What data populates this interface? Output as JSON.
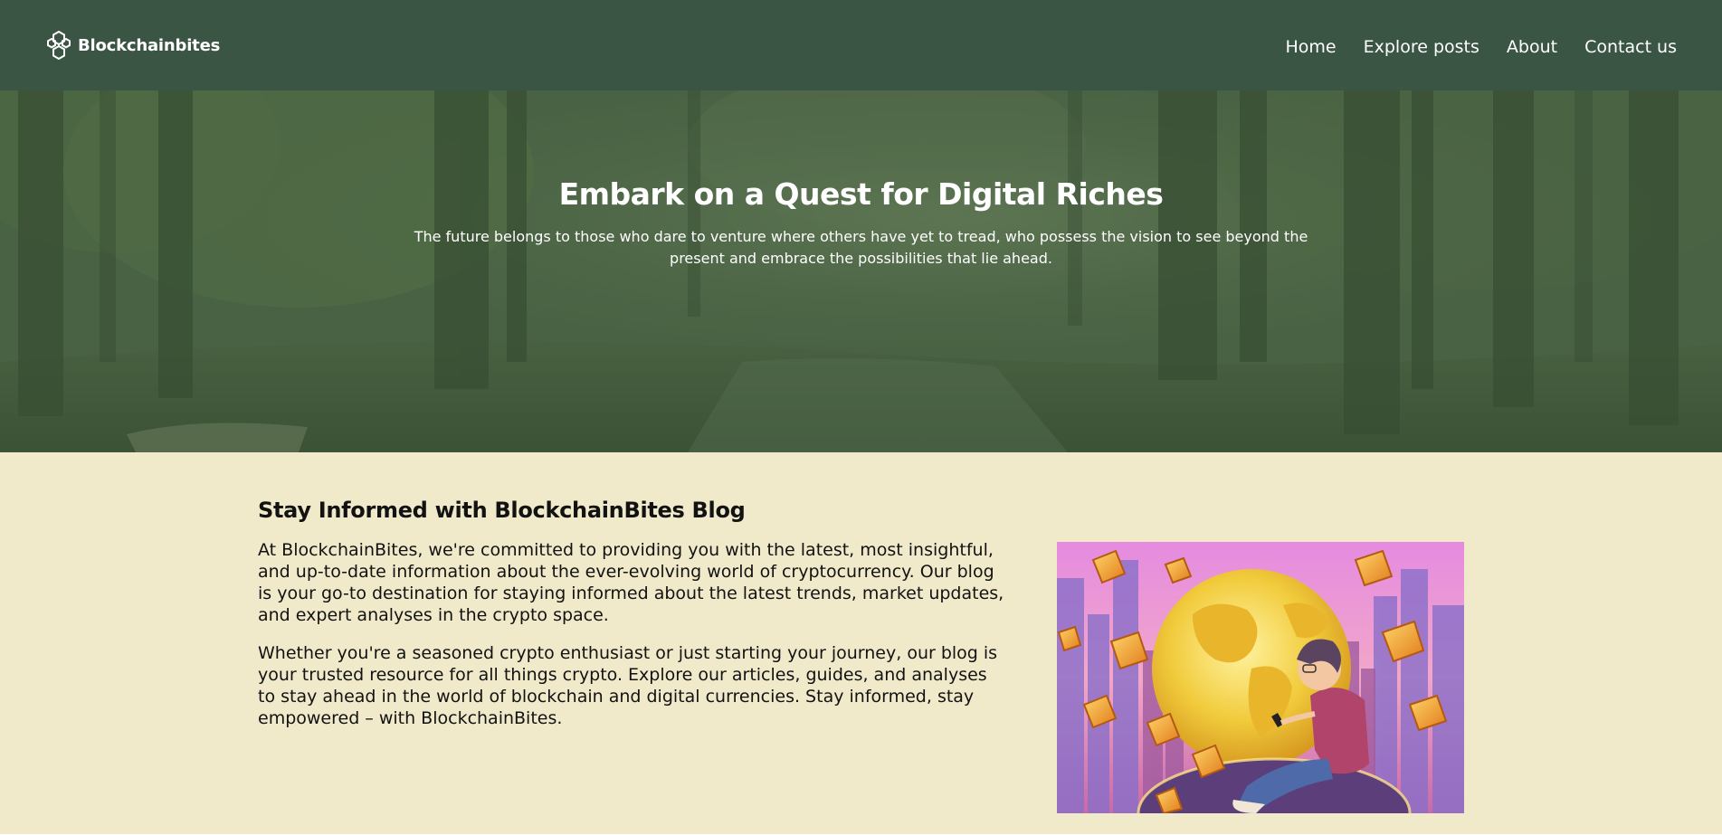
{
  "brand": {
    "name": "Blockchainbites",
    "logo_icon": "hexagon-network-logo-icon"
  },
  "nav": {
    "items": [
      {
        "label": "Home"
      },
      {
        "label": "Explore posts"
      },
      {
        "label": "About"
      },
      {
        "label": "Contact us"
      }
    ]
  },
  "hero": {
    "title": "Embark on a Quest for Digital Riches",
    "text": "The future belongs to those who dare to venture where others have yet to tread, who possess the vision to see beyond the present and embrace the possibilities that lie ahead."
  },
  "blog": {
    "title": "Stay Informed with BlockchainBites Blog",
    "paragraphs": [
      "At BlockchainBites, we're committed to providing you with the latest, most insightful, and up-to-date information about the ever-evolving world of cryptocurrency. Our blog is your go-to destination for staying informed about the latest trends, market updates, and expert analyses in the crypto space.",
      "Whether you're a seasoned crypto enthusiast or just starting your journey, our blog is your trusted resource for all things crypto. Explore our articles, guides, and analyses to stay ahead in the world of blockchain and digital currencies. Stay informed, stay empowered – with BlockchainBites."
    ]
  },
  "colors": {
    "header_bg": "#3b5545",
    "hero_bg": "#4b6546",
    "section_bg": "#f0eaca",
    "text_dark": "#121212",
    "text_light": "#ffffff"
  }
}
